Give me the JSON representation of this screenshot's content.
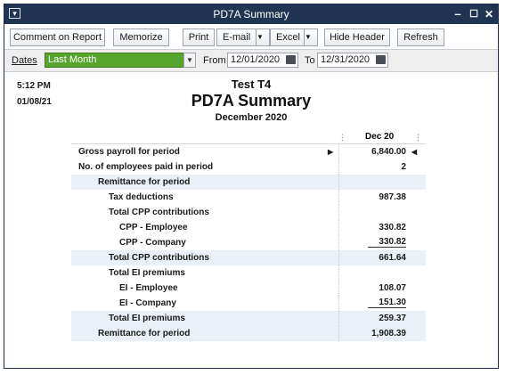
{
  "window": {
    "title": "PD7A Summary",
    "sys_glyph": "▾",
    "min_glyph": "–",
    "max_glyph": "☐",
    "close_glyph": "✕"
  },
  "toolbar": {
    "comment_on_report": "Comment on Report",
    "memorize": "Memorize",
    "print": "Print",
    "email": "E-mail",
    "excel": "Excel",
    "hide_header": "Hide Header",
    "refresh": "Refresh",
    "dropdown_glyph": "▼"
  },
  "filters": {
    "dates_label": "Dates",
    "dates_value": "Last Month",
    "from_label": "From",
    "from_value": "12/01/2020",
    "to_label": "To",
    "to_value": "12/31/2020",
    "dropdown_glyph": "▼"
  },
  "report": {
    "time": "5:12 PM",
    "date": "01/08/21",
    "company": "Test T4",
    "title": "PD7A Summary",
    "period": "December 2020",
    "column_header": "Dec 20",
    "rows": [
      {
        "label": "Gross payroll for period",
        "value": "6,840.00",
        "indent": 0,
        "shaded": false,
        "underline": false
      },
      {
        "label": "No. of employees paid in period",
        "value": "2",
        "indent": 0,
        "shaded": false,
        "underline": false
      },
      {
        "label": "Remittance for period",
        "value": "",
        "indent": 1,
        "shaded": true,
        "underline": false
      },
      {
        "label": "Tax deductions",
        "value": "987.38",
        "indent": 2,
        "shaded": false,
        "underline": false
      },
      {
        "label": "Total CPP contributions",
        "value": "",
        "indent": 2,
        "shaded": false,
        "underline": false
      },
      {
        "label": "CPP - Employee",
        "value": "330.82",
        "indent": 3,
        "shaded": false,
        "underline": false
      },
      {
        "label": "CPP - Company",
        "value": "330.82",
        "indent": 3,
        "shaded": false,
        "underline": true
      },
      {
        "label": "Total CPP contributions",
        "value": "661.64",
        "indent": 2,
        "shaded": true,
        "underline": false
      },
      {
        "label": "Total EI premiums",
        "value": "",
        "indent": 2,
        "shaded": false,
        "underline": false
      },
      {
        "label": "EI - Employee",
        "value": "108.07",
        "indent": 3,
        "shaded": false,
        "underline": false
      },
      {
        "label": "EI - Company",
        "value": "151.30",
        "indent": 3,
        "shaded": false,
        "underline": true
      },
      {
        "label": "Total EI premiums",
        "value": "259.37",
        "indent": 2,
        "shaded": true,
        "underline": false
      },
      {
        "label": "Remittance for period",
        "value": "1,908.39",
        "indent": 1,
        "shaded": true,
        "underline": false
      }
    ]
  },
  "colors": {
    "titlebar": "#223453",
    "dates_select": "#58a52d",
    "row_shade": "#eaf0f7"
  }
}
